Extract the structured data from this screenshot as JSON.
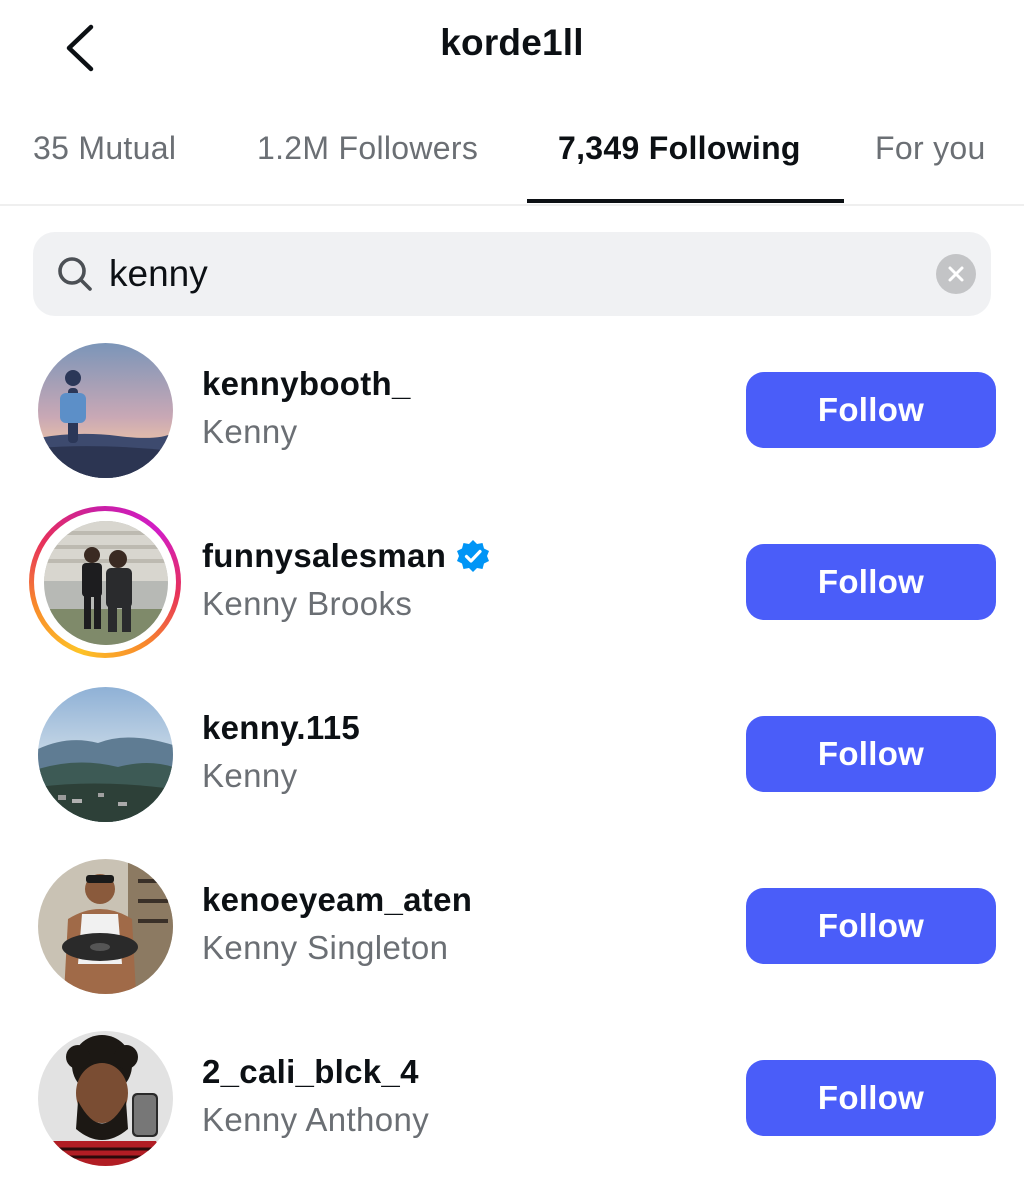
{
  "header": {
    "title": "korde1ll",
    "back_icon": "chevron-left-icon"
  },
  "tabs": [
    {
      "label": "35 Mutual",
      "active": false
    },
    {
      "label": "1.2M Followers",
      "active": false
    },
    {
      "label": "7,349 Following",
      "active": true
    },
    {
      "label": "For you",
      "active": false
    }
  ],
  "search": {
    "value": "kenny",
    "icon": "search-icon",
    "clear_icon": "clear-icon"
  },
  "accounts": [
    {
      "username": "kennybooth_",
      "name": "Kenny",
      "verified": false,
      "story_ring": false,
      "button": "Follow"
    },
    {
      "username": "funnysalesman",
      "name": "Kenny Brooks",
      "verified": true,
      "story_ring": true,
      "button": "Follow"
    },
    {
      "username": "kenny.115",
      "name": "Kenny",
      "verified": false,
      "story_ring": false,
      "button": "Follow"
    },
    {
      "username": "kenoeyeam_aten",
      "name": "Kenny Singleton",
      "verified": false,
      "story_ring": false,
      "button": "Follow"
    },
    {
      "username": "2_cali_blck_4",
      "name": "Kenny Anthony",
      "verified": false,
      "story_ring": false,
      "button": "Follow"
    }
  ],
  "colors": {
    "follow_button": "#4a5df9",
    "verified_badge": "#0095f6",
    "secondary_text": "#6b6f74",
    "search_background": "#f0f1f3"
  }
}
